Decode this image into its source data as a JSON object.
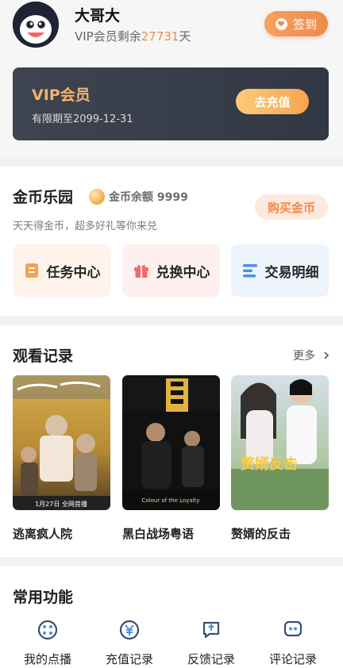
{
  "profile": {
    "username": "大哥大",
    "vip_prefix": "VIP会员剩余",
    "vip_days": "27731",
    "vip_suffix": "天",
    "signin_label": "签到"
  },
  "vip_card": {
    "title": "VIP会员",
    "expire": "有限期至2099-12-31",
    "action": "去充值"
  },
  "coins": {
    "title": "金币乐园",
    "balance_label": "金币余额 9999",
    "subtitle": "天天得金币，超多好礼等你来兑",
    "buy_label": "购买金币",
    "tiles": [
      {
        "label": "任务中心",
        "icon": "task-icon"
      },
      {
        "label": "兑换中心",
        "icon": "gift-icon"
      },
      {
        "label": "交易明细",
        "icon": "list-icon"
      }
    ]
  },
  "history": {
    "title": "观看记录",
    "more_label": "更多",
    "items": [
      {
        "title": "逃离疯人院",
        "poster_text": "1月27日 全网首播"
      },
      {
        "title": "黑白战场粤语",
        "poster_text": "Colour of the Loyalty"
      },
      {
        "title": "赘婿的反击",
        "poster_text": "赘婿反击"
      }
    ]
  },
  "functions": {
    "title": "常用功能",
    "items": [
      {
        "label": "我的点播",
        "icon": "play-dots-icon"
      },
      {
        "label": "充值记录",
        "icon": "yen-icon"
      },
      {
        "label": "反馈记录",
        "icon": "feedback-icon"
      },
      {
        "label": "评论记录",
        "icon": "comment-icon"
      }
    ]
  }
}
